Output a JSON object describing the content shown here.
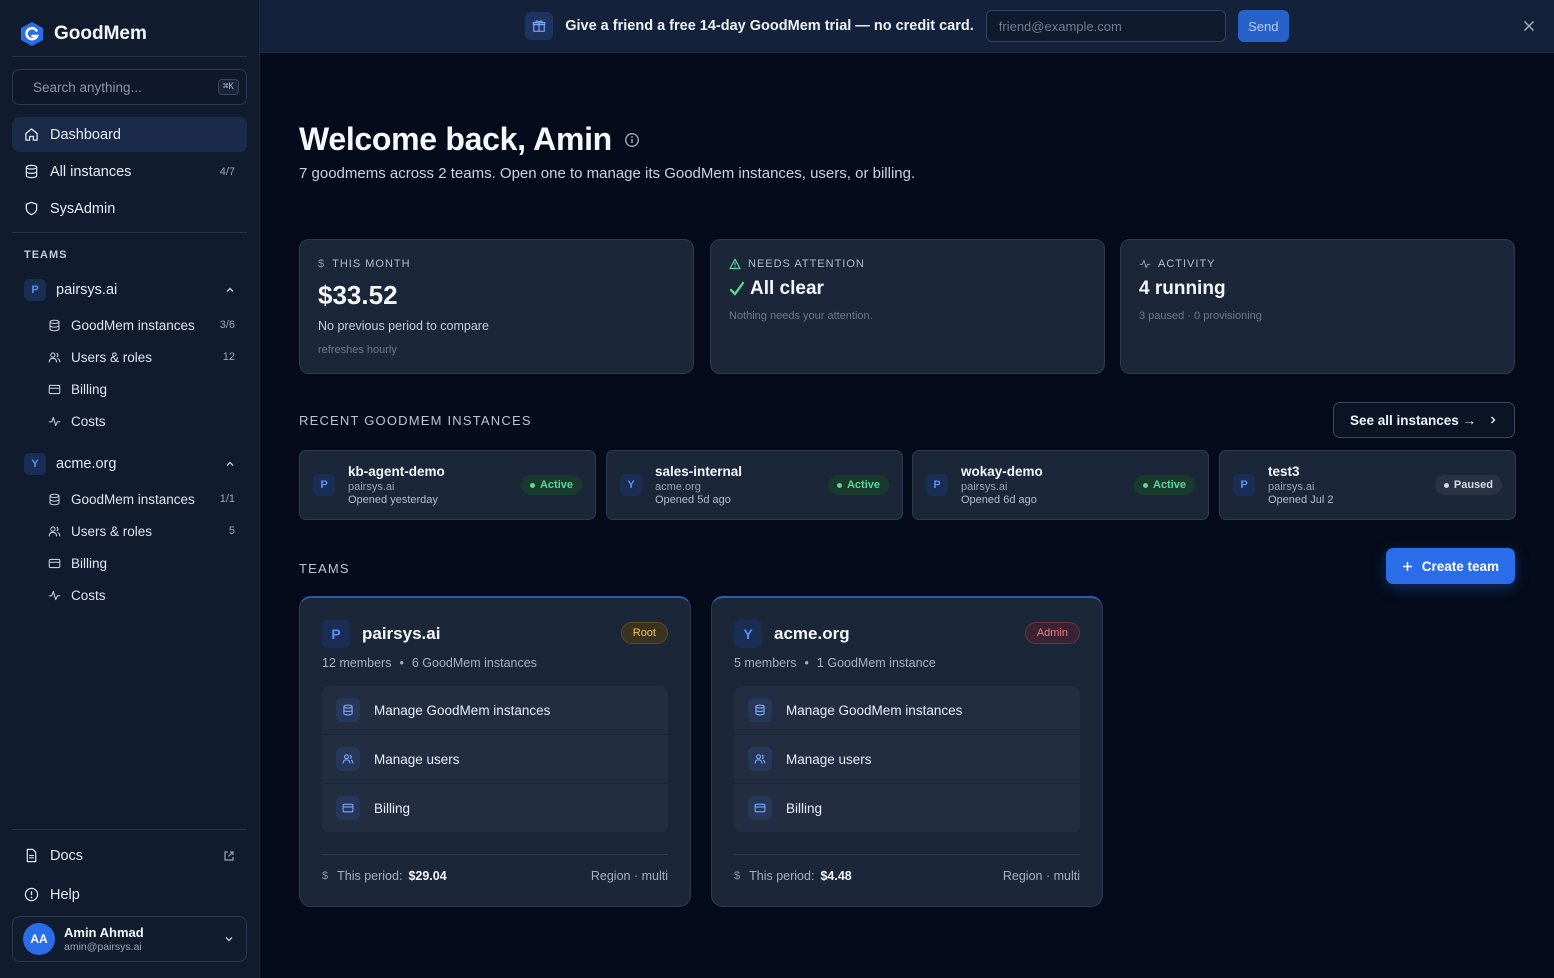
{
  "brand": {
    "name": "GoodMem"
  },
  "search": {
    "placeholder": "Search anything...",
    "shortcut": "⌘K"
  },
  "nav": [
    {
      "label": "Dashboard",
      "count": ""
    },
    {
      "label": "All instances",
      "count": "4/7"
    },
    {
      "label": "SysAdmin",
      "count": ""
    }
  ],
  "sidebar_teams": {
    "label": "TEAMS",
    "items": [
      {
        "avatar": "P",
        "name": "pairsys.ai",
        "subs": [
          {
            "label": "GoodMem instances",
            "count": "3/6"
          },
          {
            "label": "Users & roles",
            "count": "12"
          },
          {
            "label": "Billing",
            "count": ""
          },
          {
            "label": "Costs",
            "count": ""
          }
        ]
      },
      {
        "avatar": "Y",
        "name": "acme.org",
        "subs": [
          {
            "label": "GoodMem instances",
            "count": "1/1"
          },
          {
            "label": "Users & roles",
            "count": "5"
          },
          {
            "label": "Billing",
            "count": ""
          },
          {
            "label": "Costs",
            "count": ""
          }
        ]
      }
    ]
  },
  "footer_nav": {
    "docs": "Docs",
    "help": "Help"
  },
  "user": {
    "initials": "AA",
    "name": "Amin Ahmad",
    "email": "amin@pairsys.ai"
  },
  "banner": {
    "text": "Give a friend a free 14-day GoodMem trial — no credit card.",
    "placeholder": "friend@example.com",
    "send": "Send"
  },
  "welcome": {
    "title": "Welcome back, Amin",
    "subtitle": "7 goodmems across 2 teams. Open one to manage its GoodMem instances, users, or billing."
  },
  "stats": {
    "month": {
      "label": "THIS MONTH",
      "value": "$33.52",
      "line1": "No previous period to compare",
      "line2": "refreshes hourly"
    },
    "attention": {
      "label": "NEEDS ATTENTION",
      "value": "All clear",
      "line1": "Nothing needs your attention."
    },
    "activity": {
      "label": "ACTIVITY",
      "value": "4 running",
      "line1": "3 paused · 0 provisioning"
    }
  },
  "recent": {
    "title": "RECENT GOODMEM INSTANCES",
    "see_all": "See all instances →",
    "items": [
      {
        "avatar": "P",
        "name": "kb-agent-demo",
        "org": "pairsys.ai",
        "opened": "Opened yesterday",
        "status": "Active"
      },
      {
        "avatar": "Y",
        "name": "sales-internal",
        "org": "acme.org",
        "opened": "Opened 5d ago",
        "status": "Active"
      },
      {
        "avatar": "P",
        "name": "wokay-demo",
        "org": "pairsys.ai",
        "opened": "Opened 6d ago",
        "status": "Active"
      },
      {
        "avatar": "P",
        "name": "test3",
        "org": "pairsys.ai",
        "opened": "Opened Jul 2",
        "status": "Paused"
      }
    ]
  },
  "teams_section": {
    "title": "TEAMS",
    "create": "Create team",
    "items": [
      {
        "avatar": "P",
        "name": "pairsys.ai",
        "role": "Root",
        "members": "12 members",
        "instances": "6 GoodMem instances",
        "links": [
          "Manage GoodMem instances",
          "Manage users",
          "Billing"
        ],
        "period_label": "This period:",
        "period_value": "$29.04",
        "region": "Region · multi"
      },
      {
        "avatar": "Y",
        "name": "acme.org",
        "role": "Admin",
        "members": "5 members",
        "instances": "1 GoodMem instance",
        "links": [
          "Manage GoodMem instances",
          "Manage users",
          "Billing"
        ],
        "period_label": "This period:",
        "period_value": "$4.48",
        "region": "Region · multi"
      }
    ]
  },
  "colors": {
    "accent": "#2a6de8",
    "active": "#5fd597",
    "root": "#f0c75e",
    "admin": "#f07a8a"
  }
}
